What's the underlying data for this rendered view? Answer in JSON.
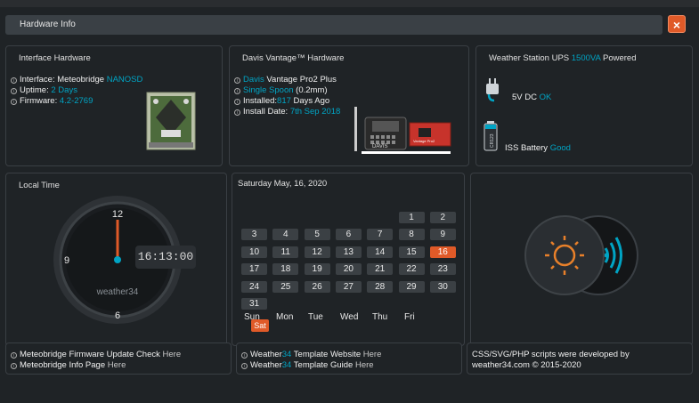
{
  "header": {
    "title": "Hardware Info",
    "close_label": "×"
  },
  "interface_panel": {
    "title": "Interface Hardware",
    "interface_label": "Interface: Meteobridge ",
    "interface_value": "NANOSD",
    "uptime_label": "Uptime: ",
    "uptime_value": "2 Days",
    "firmware_label": "Firmware: ",
    "firmware_value": "4.2-2769"
  },
  "davis_panel": {
    "title": "Davis Vantage™ Hardware",
    "line1_brand": "Davis",
    "line1_rest": " Vantage Pro2 Plus",
    "line2_value": "Single Spoon",
    "line2_rest": " (0.2mm)",
    "line3_label": "Installed:",
    "line3_value": "817",
    "line3_rest": " Days Ago",
    "line4_label": "Install Date: ",
    "line4_value": "7th Sep 2018",
    "console_label": "DAVIS",
    "board_label": "Vantage Pro2"
  },
  "ups_panel": {
    "title_prefix": "Weather Station UPS ",
    "title_value": "1500VA",
    "title_suffix": " Powered",
    "dc_label": "5V DC ",
    "dc_status": "OK",
    "battery_label": "ISS Battery ",
    "battery_status": "Good",
    "battery_text": "CR123"
  },
  "clock_panel": {
    "title": "Local Time",
    "n12": "12",
    "n9": "9",
    "n6": "6",
    "digital": "16:13:00",
    "brand": "weather34",
    "seconds_fraction": 0.0
  },
  "calendar": {
    "title": "Saturday May, 16, 2020",
    "rows": [
      [
        "",
        "",
        "",
        "",
        "",
        "1",
        "2"
      ],
      [
        "3",
        "4",
        "5",
        "6",
        "7",
        "8",
        "9"
      ],
      [
        "10",
        "11",
        "12",
        "13",
        "14",
        "15",
        "16"
      ],
      [
        "17",
        "18",
        "19",
        "20",
        "21",
        "22",
        "23"
      ],
      [
        "24",
        "25",
        "26",
        "27",
        "28",
        "29",
        "30"
      ],
      [
        "31",
        "",
        "",
        "",
        "",
        "",
        ""
      ]
    ],
    "today": "16",
    "weekdays": [
      "Sun",
      "Mon",
      "Tue",
      "Wed",
      "Thu",
      "Fri"
    ],
    "sat": "Sat"
  },
  "footer": {
    "mb_update": "Meteobridge Firmware Update Check ",
    "mb_update_link": "Here",
    "mb_info": "Meteobridge Info Page ",
    "mb_info_link": "Here",
    "w34_site_a": "Weather",
    "w34_site_b": "34",
    "w34_site_c": " Template Website ",
    "w34_site_link": "Here",
    "w34_guide_a": "Weather",
    "w34_guide_b": "34",
    "w34_guide_c": " Template Guide ",
    "w34_guide_link": "Here",
    "credit_line1": "CSS/SVG/PHP scripts were developed by",
    "credit_site": "weather34.com",
    "credit_rest": " © 2015-2020"
  },
  "colors": {
    "accent_orange": "#e05a28",
    "accent_blue": "#00a4c4",
    "panel_bg": "#1f2326"
  }
}
